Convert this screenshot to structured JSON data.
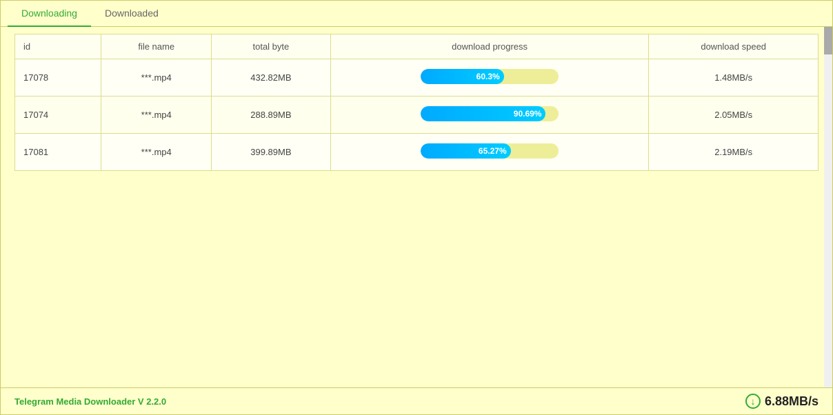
{
  "tabs": [
    {
      "label": "Downloading",
      "active": true
    },
    {
      "label": "Downloaded",
      "active": false
    }
  ],
  "table": {
    "headers": [
      "id",
      "file name",
      "total byte",
      "download progress",
      "download speed"
    ],
    "rows": [
      {
        "id": "17078",
        "file_name": "***.mp4",
        "total_byte": "432.82MB",
        "progress_pct": 60.3,
        "progress_label": "60.3%",
        "download_speed": "1.48MB/s"
      },
      {
        "id": "17074",
        "file_name": "***.mp4",
        "total_byte": "288.89MB",
        "progress_pct": 90.69,
        "progress_label": "90.69%",
        "download_speed": "2.05MB/s"
      },
      {
        "id": "17081",
        "file_name": "***.mp4",
        "total_byte": "399.89MB",
        "progress_pct": 65.27,
        "progress_label": "65.27%",
        "download_speed": "2.19MB/s"
      }
    ]
  },
  "footer": {
    "brand_text": "Telegram Media Downloader",
    "version": "V 2.2.0",
    "total_speed": "6.88MB/s"
  }
}
